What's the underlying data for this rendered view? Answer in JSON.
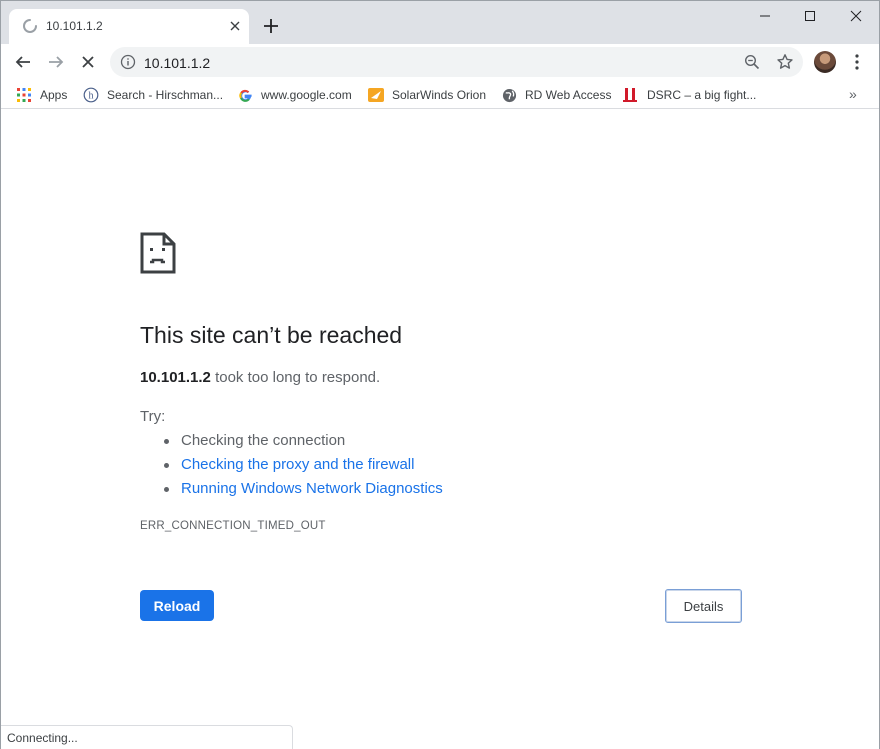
{
  "tab": {
    "title": "10.101.1.2"
  },
  "omnibox": {
    "url": "10.101.1.2"
  },
  "bookmarks": [
    {
      "label": "Apps",
      "icon": "apps-grid-icon"
    },
    {
      "label": "Search - Hirschman...",
      "icon": "hirschmann-icon"
    },
    {
      "label": "www.google.com",
      "icon": "google-icon"
    },
    {
      "label": "SolarWinds Orion",
      "icon": "solarwinds-icon"
    },
    {
      "label": "RD Web Access",
      "icon": "globe-icon"
    },
    {
      "label": "DSRC – a big fight...",
      "icon": "dsrc-icon"
    }
  ],
  "error": {
    "title": "This site can’t be reached",
    "host": "10.101.1.2",
    "desc_suffix": " took too long to respond.",
    "try_label": "Try:",
    "suggestions": [
      "Checking the connection",
      "Checking the proxy and the firewall",
      "Running Windows Network Diagnostics"
    ],
    "code": "ERR_CONNECTION_TIMED_OUT",
    "reload_label": "Reload",
    "details_label": "Details"
  },
  "status": {
    "text": "Connecting..."
  },
  "colors": {
    "accent": "#1a73e8",
    "tabstrip": "#dee1e6",
    "omnibox": "#f1f3f4"
  }
}
